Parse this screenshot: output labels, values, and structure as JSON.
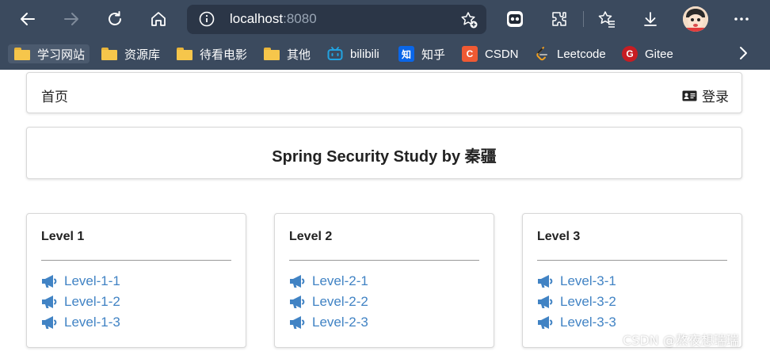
{
  "browser": {
    "address": {
      "host": "localhost",
      "port": ":8080"
    },
    "bookmarks": [
      {
        "label": "学习网站",
        "icon": "folder-icon"
      },
      {
        "label": "资源库",
        "icon": "folder-icon"
      },
      {
        "label": "待看电影",
        "icon": "folder-icon"
      },
      {
        "label": "其他",
        "icon": "folder-icon"
      },
      {
        "label": "bilibili",
        "icon": "bilibili-icon"
      },
      {
        "label": "知乎",
        "icon": "zhihu-icon",
        "icon_text": "知"
      },
      {
        "label": "CSDN",
        "icon": "csdn-icon",
        "icon_text": "C"
      },
      {
        "label": "Leetcode",
        "icon": "leetcode-icon"
      },
      {
        "label": "Gitee",
        "icon": "gitee-icon",
        "icon_text": "G"
      }
    ],
    "colors": {
      "chrome": "#3b4a5e",
      "address_bg": "#2b3647"
    }
  },
  "nav": {
    "home": "首页",
    "login": "登录"
  },
  "title": "Spring Security Study by 秦疆",
  "levels": [
    {
      "heading": "Level 1",
      "links": [
        "Level-1-1",
        "Level-1-2",
        "Level-1-3"
      ]
    },
    {
      "heading": "Level 2",
      "links": [
        "Level-2-1",
        "Level-2-2",
        "Level-2-3"
      ]
    },
    {
      "heading": "Level 3",
      "links": [
        "Level-3-1",
        "Level-3-2",
        "Level-3-3"
      ]
    }
  ],
  "link_color": "#4183c4",
  "watermark": "CSDN @熬夜想瑞瑞"
}
